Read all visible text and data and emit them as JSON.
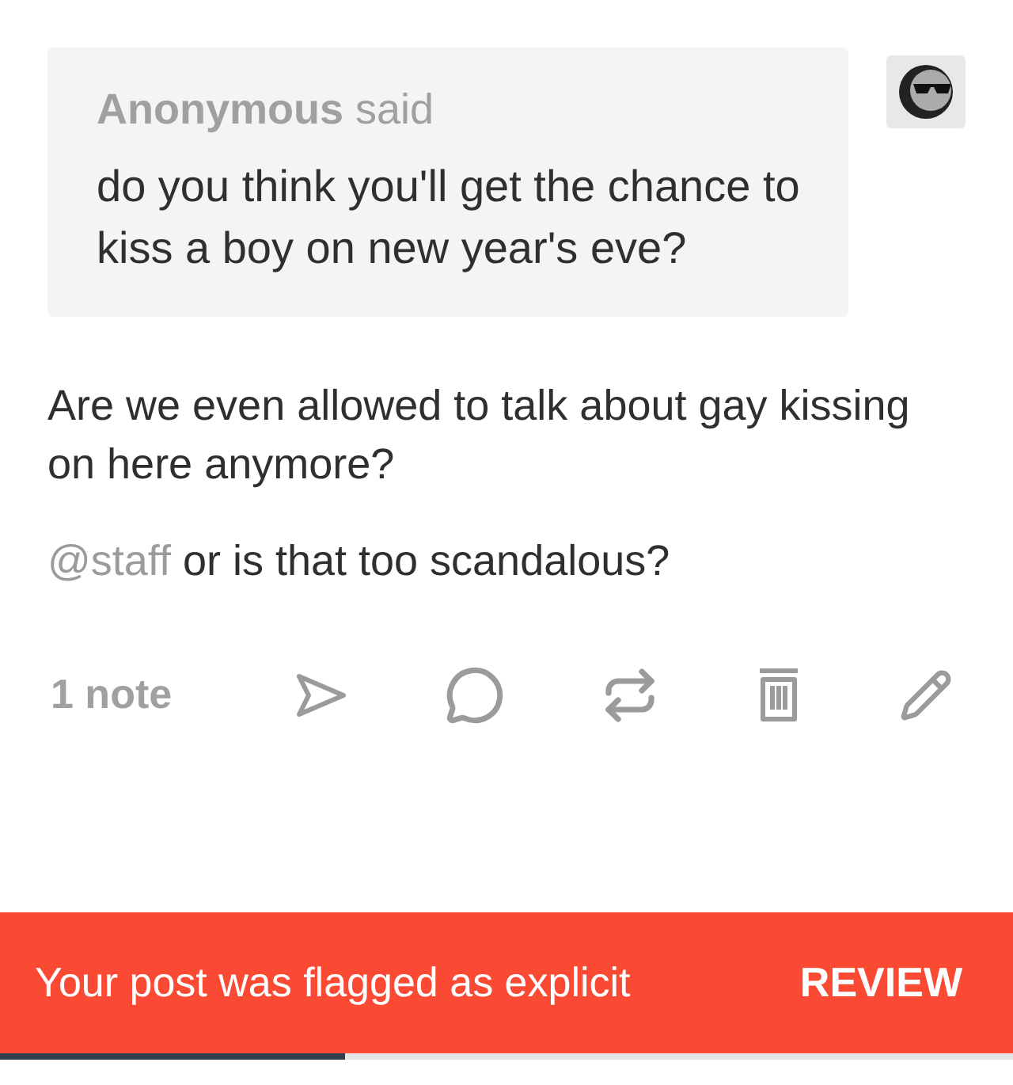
{
  "ask": {
    "asker": "Anonymous",
    "verb": "said",
    "question": "do you think you'll get the chance to kiss a boy on new year's eve?"
  },
  "answer": [
    {
      "text": "Are we even allowed to talk about gay kissing on here anymore?"
    },
    {
      "mention": "@staff",
      "text": " or is that too scandalous?"
    }
  ],
  "footer": {
    "notes": "1 note",
    "actions": [
      {
        "kind": "share"
      },
      {
        "kind": "reply"
      },
      {
        "kind": "reblog"
      },
      {
        "kind": "delete"
      },
      {
        "kind": "edit"
      }
    ]
  },
  "banner": {
    "message": "Your post was flagged as explicit",
    "action": "REVIEW"
  },
  "progress": {
    "level": 0.34
  }
}
